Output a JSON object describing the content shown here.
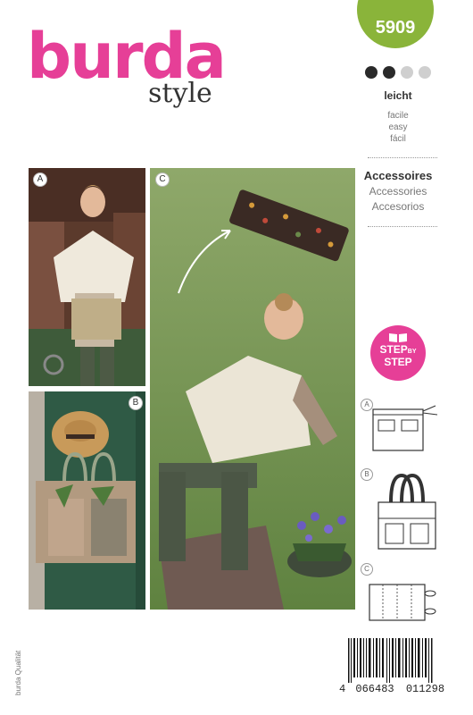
{
  "brand": {
    "name": "burda",
    "sub": "style"
  },
  "pattern_number": "5909",
  "difficulty": {
    "level_filled": 2,
    "level_total": 4,
    "label_de": "leicht",
    "label_fr": "facile",
    "label_en": "easy",
    "label_es": "fácil"
  },
  "category": {
    "label_de": "Accessoires",
    "label_en": "Accessories",
    "label_es": "Accesorios"
  },
  "views": {
    "a": "A",
    "b": "B",
    "c": "C"
  },
  "step_badge": {
    "line1": "STEP",
    "by": "BY",
    "line2": "STEP"
  },
  "technical": {
    "a": "A",
    "b": "B",
    "c": "C"
  },
  "barcode": {
    "first": "4",
    "group1": "066483",
    "group2": "011298"
  },
  "quality_text": "burda Qualität",
  "colors": {
    "brand_pink": "#e63f97",
    "badge_green": "#8ab43a"
  }
}
